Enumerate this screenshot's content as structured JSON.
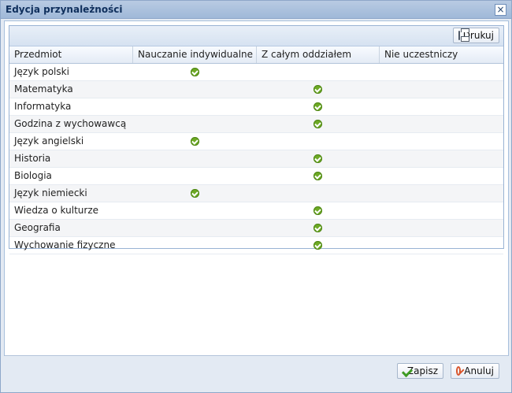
{
  "dialog": {
    "title": "Edycja przynależności",
    "close_label": "×"
  },
  "toolbar": {
    "print_label": "Drukuj"
  },
  "table": {
    "columns": [
      "Przedmiot",
      "Nauczanie indywidualne",
      "Z całym oddziałem",
      "Nie uczestniczy"
    ],
    "rows": [
      {
        "subject": "Język polski",
        "selected_column": 1
      },
      {
        "subject": "Matematyka",
        "selected_column": 2
      },
      {
        "subject": "Informatyka",
        "selected_column": 2
      },
      {
        "subject": "Godzina z wychowawcą",
        "selected_column": 2
      },
      {
        "subject": "Język angielski",
        "selected_column": 1
      },
      {
        "subject": "Historia",
        "selected_column": 2
      },
      {
        "subject": "Biologia",
        "selected_column": 2
      },
      {
        "subject": "Język niemiecki",
        "selected_column": 1
      },
      {
        "subject": "Wiedza o kulturze",
        "selected_column": 2
      },
      {
        "subject": "Geografia",
        "selected_column": 2
      },
      {
        "subject": "Wychowanie fizyczne",
        "selected_column": 2
      }
    ]
  },
  "footer": {
    "save_label": "Zapisz",
    "cancel_label": "Anuluj"
  },
  "colors": {
    "window_border": "#8ea7c9",
    "accent": "#6eaa25",
    "cancel_icon": "#d9542b"
  },
  "icons": {
    "print": "printer-icon",
    "save": "checkmark-icon",
    "cancel": "cancel-icon",
    "selected": "check-circle-icon",
    "close": "close-icon"
  }
}
